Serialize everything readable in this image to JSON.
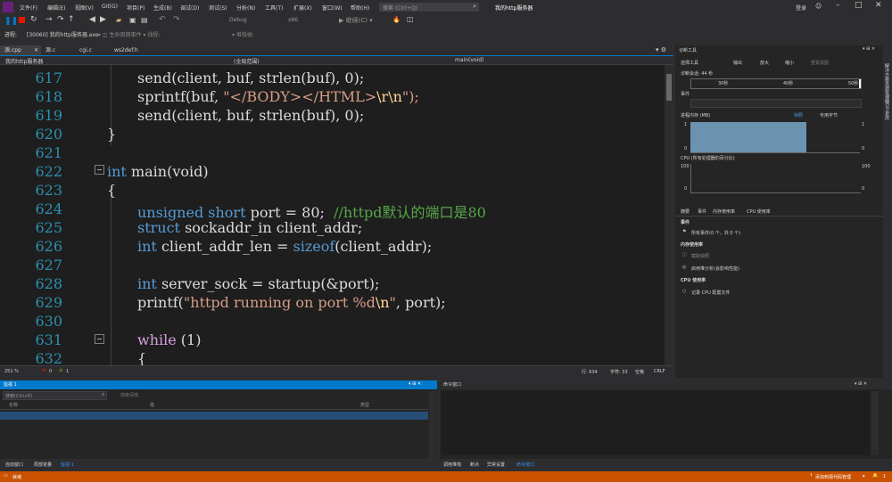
{
  "menu": {
    "items": [
      "文件(F)",
      "编辑(E)",
      "视图(V)",
      "Git(G)",
      "项目(P)",
      "生成(B)",
      "调试(D)",
      "测试(S)",
      "分析(N)",
      "工具(T)",
      "扩展(X)",
      "窗口(W)",
      "帮助(H)"
    ],
    "search_placeholder": "搜索 (Ctrl+Q)",
    "project_title": "我的http服务器",
    "login": "登录",
    "live_share": "Live Share"
  },
  "toolbar": {
    "config": "Debug",
    "platform": "x86",
    "process_label": "进程:",
    "process_value": "[30060] 我的http服务器.exe"
  },
  "tabs": [
    {
      "label": "源.cpp",
      "active": true
    },
    {
      "label": "源.c",
      "active": false
    },
    {
      "label": "cgi.c",
      "active": false
    },
    {
      "label": "ws2def.h",
      "active": false
    }
  ],
  "navbar": {
    "project": "我的http服务器",
    "scope": "(全局范围)",
    "function": "main(void)"
  },
  "editor": {
    "lines": [
      {
        "n": "617"
      },
      {
        "n": "618"
      },
      {
        "n": "619"
      },
      {
        "n": "620"
      },
      {
        "n": "621"
      },
      {
        "n": "622"
      },
      {
        "n": "623"
      },
      {
        "n": "624"
      },
      {
        "n": "625"
      },
      {
        "n": "626"
      },
      {
        "n": "627"
      },
      {
        "n": "628"
      },
      {
        "n": "629"
      },
      {
        "n": "630"
      },
      {
        "n": "631"
      },
      {
        "n": "632"
      }
    ],
    "code": {
      "l617": "send(client, buf, strlen(buf), 0);",
      "l618a": "sprintf(buf, ",
      "l618b": "\"</BODY></HTML>",
      "l618c": "\\r\\n",
      "l618d": "\");",
      "l619": "send(client, buf, strlen(buf), 0);",
      "l620": "}",
      "l622a": "int",
      "l622b": " main(void)",
      "l623": "{",
      "l624a": "unsigned short",
      "l624b": " port = 80;  ",
      "l624c": "//httpd默认的端口是80",
      "l625a": "struct",
      "l625b": " sockaddr_in client_addr;",
      "l626a": "int",
      "l626b": " client_addr_len = ",
      "l626c": "sizeof",
      "l626d": "(client_addr);",
      "l628a": "int",
      "l628b": " server_sock = startup(&port);",
      "l629a": "printf(",
      "l629b": "\"httpd running on port %d",
      "l629c": "\\n",
      "l629d": "\"",
      "l629e": ", port);",
      "l631a": "while",
      "l631b": " (1)",
      "l632": "{"
    }
  },
  "editor_status": {
    "zoom": "251 %",
    "errors": "0",
    "warnings": "1",
    "line": "行: 634",
    "char": "字符: 33",
    "mode": "空格",
    "eol": "CRLF"
  },
  "diag": {
    "title": "诊断工具",
    "select_tool": "选择工具",
    "output": "输出",
    "zoom_in": "放大",
    "zoom_out": "缩小",
    "reset_view": "重置视图",
    "session": "诊断会话: 44 秒",
    "ticks": [
      "30秒",
      "40秒",
      "50秒"
    ],
    "events_section": "事件",
    "memory_section": "进程内存 (MB)",
    "snapshot": "快照",
    "private_bytes": "专用字节",
    "mem_max": "1",
    "mem_min": "0",
    "cpu_section": "CPU (所有处理器的百分比)",
    "cpu_max": "100",
    "cpu_min": "0",
    "tabs": [
      "摘要",
      "事件",
      "内存使用率",
      "CPU 使用率"
    ],
    "summary_events": "事件",
    "all_events": "所有事件(0 个，共 0 个)",
    "mem_usage": "内存使用率",
    "take_snapshot": "截取快照",
    "heap_profile": "启用堆分析(会影响性能)",
    "cpu_usage": "CPU 使用率",
    "record_cpu": "记录 CPU 配置文件"
  },
  "watch": {
    "title": "监视 1",
    "search_placeholder": "搜索(Ctrl+E)",
    "search_depth": "搜索深度:",
    "columns": [
      "名称",
      "值",
      "类型"
    ]
  },
  "command": {
    "title": "命令窗口"
  },
  "bottom_tabs_left": [
    "自动窗口",
    "局部变量",
    "监视 1"
  ],
  "bottom_tabs_right": [
    "调用堆栈",
    "断点",
    "异常设置",
    "命令窗口"
  ],
  "status": {
    "ready": "就绪",
    "add_source": "添加到源代码管理",
    "notifications": "1"
  },
  "colors": {
    "accent": "#007acc",
    "status_bar": "#ca5100",
    "editor_bg": "#1e1e1e",
    "line_number": "#2b91af",
    "keyword": "#569cd6",
    "string": "#d69d85",
    "comment": "#57a64a"
  }
}
